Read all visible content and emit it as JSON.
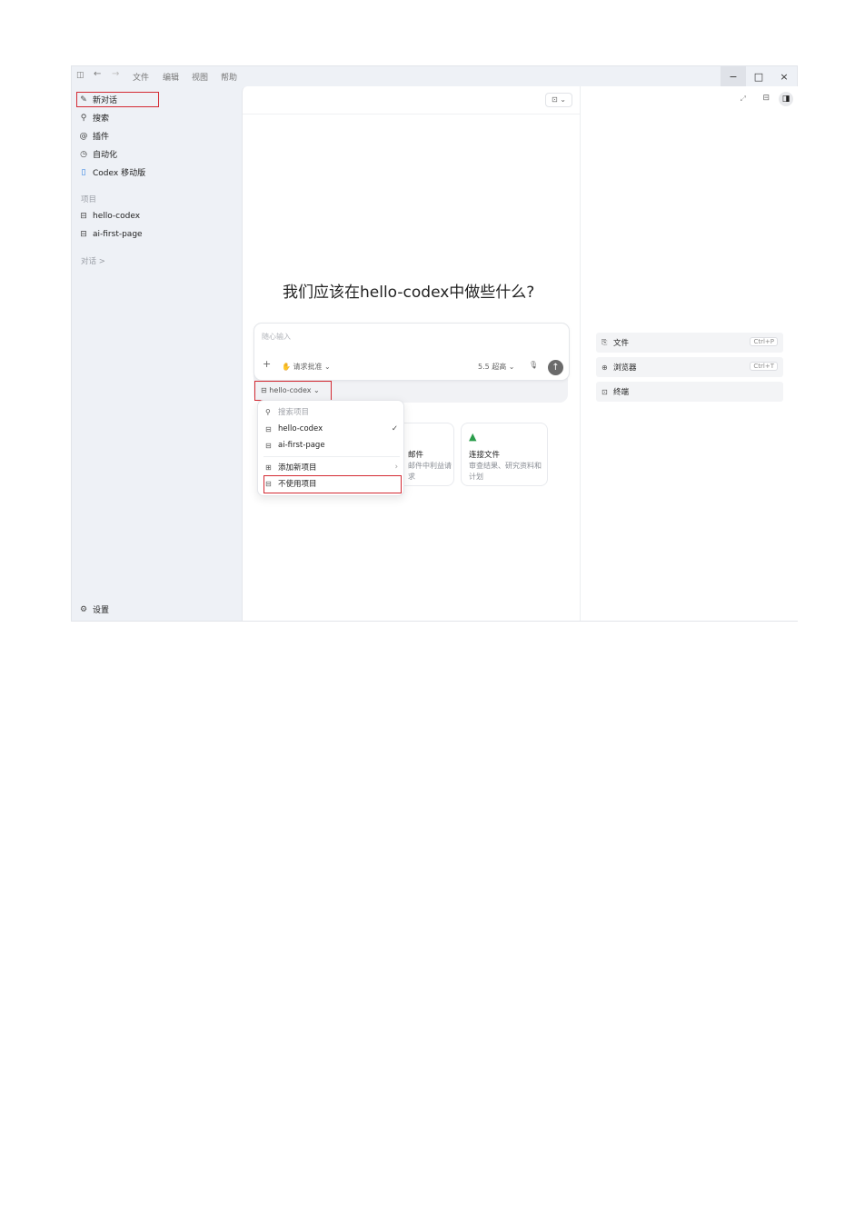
{
  "menu": [
    "文件",
    "编辑",
    "视图",
    "帮助"
  ],
  "window_controls": {
    "minimize": "−",
    "maximize": "□",
    "close": "×"
  },
  "sidebar": {
    "nav": [
      {
        "label": "新对话",
        "icon": "edit-icon"
      },
      {
        "label": "搜索",
        "icon": "search-icon"
      },
      {
        "label": "插件",
        "icon": "at-icon"
      },
      {
        "label": "自动化",
        "icon": "clock-icon"
      },
      {
        "label": "Codex 移动版",
        "icon": "phone-icon"
      }
    ],
    "projects_title": "项目",
    "projects": [
      "hello-codex",
      "ai-first-page"
    ],
    "chats_title": "对话 >",
    "settings": "设置"
  },
  "main": {
    "heading": "我们应该在hello-codex中做些什么?",
    "input_placeholder": "随心输入",
    "approval": "请求批准",
    "model": "5.5 超高",
    "project_selector": "hello-codex",
    "cards": [
      {
        "title": "邮件",
        "desc": "邮件中利益请求"
      },
      {
        "title": "连接文件",
        "desc": "审查结果、研究资料和计划"
      }
    ]
  },
  "dropdown": {
    "search_placeholder": "搜索项目",
    "items": [
      "hello-codex",
      "ai-first-page"
    ],
    "add": "添加新项目",
    "no_project": "不使用项目"
  },
  "right_panel": [
    {
      "label": "文件",
      "shortcut": "Ctrl+P",
      "icon": "file-icon"
    },
    {
      "label": "浏览器",
      "shortcut": "Ctrl+T",
      "icon": "globe-icon"
    },
    {
      "label": "终端",
      "shortcut": "",
      "icon": "terminal-icon"
    }
  ],
  "colors": {
    "highlight": "#d42a33",
    "sidebar_bg": "#eef1f6"
  }
}
